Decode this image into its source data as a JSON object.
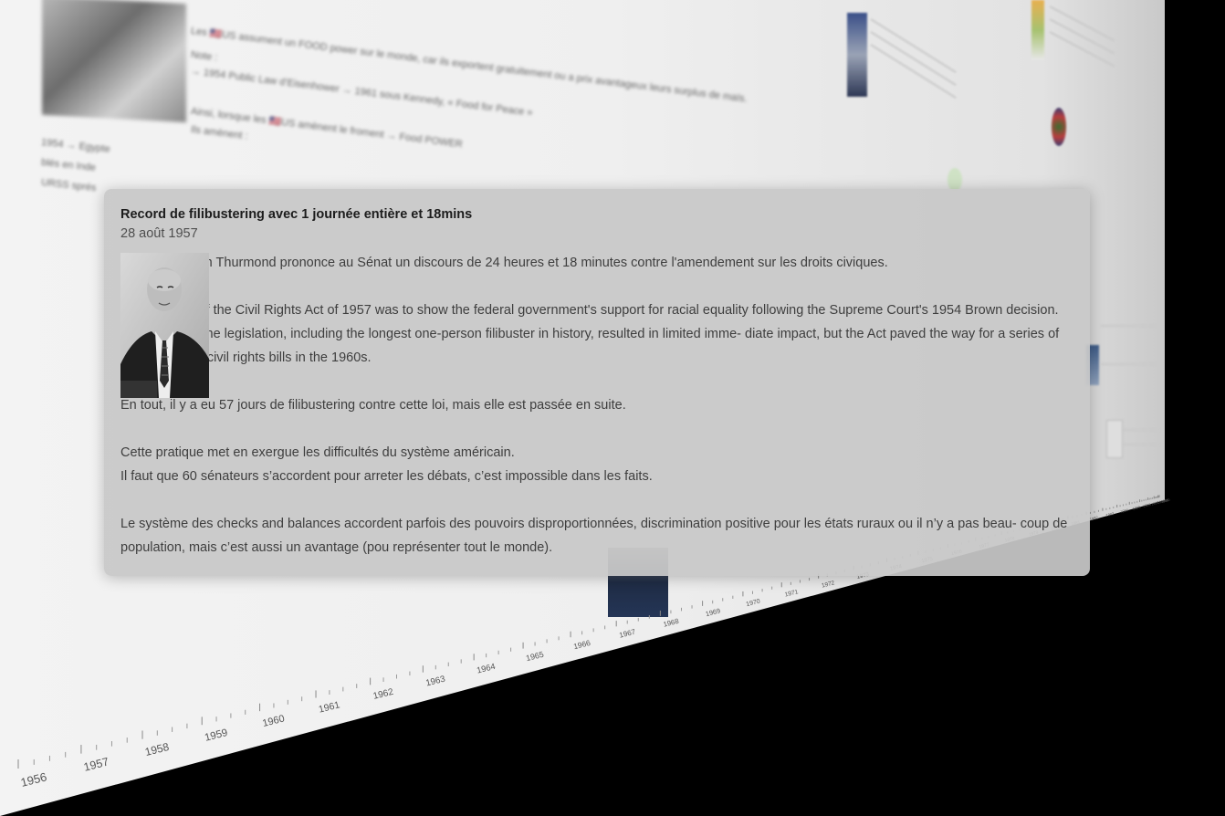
{
  "card": {
    "title": "Record de filibustering avec 1 journée entière et 18mins",
    "date": "28 août 1957",
    "paragraphs": [
      "En 1957, Strom Thurmond prononce au Sénat un discours de 24 heures et 18 minutes contre l'amendement sur les droits civiques.",
      "The purpose of the Civil Rights Act of 1957 was to show the federal government's support for racial equality following the Supreme Court's 1954 Brown decision. Opposition to the legislation, including the longest one-person filibuster in history, resulted in limited imme- diate impact, but the Act paved the way for a series of more effective civil rights bills in the 1960s.",
      "En tout, il y a eu 57 jours de filibustering contre cette loi, mais elle est passée en suite.",
      "Cette pratique met en exergue les difficultés du système américain.",
      "Il faut que 60 sénateurs s’accordent pour arreter les débats, c’est impossible dans les faits.",
      "Le système des checks and balances accordent parfois des pouvoirs disproportionnées, discrimination positive pour les états ruraux ou il n’y a pas beau- coup de population, mais c’est aussi un avantage (pou représenter tout le monde)."
    ],
    "image": "portrait-photo"
  },
  "background": {
    "text_lines": [
      "Les 🇺🇸US assument un FOOD power sur le monde, car ils exportent gratuitement ou a prix avantageux leurs surplus de maïs.",
      "Note :",
      "→ 1954 Public Law d’Eisenhower → 1961 sous Kennedy, « Food for Peace »",
      "Ainsi, lorsque les 🇺🇸US amènent le froment → Food POWER",
      "Ils amènent :",
      "1954 → Egypte",
      "blés en Inde",
      "URSS sprés"
    ]
  },
  "timeline": {
    "years": [
      "1956",
      "1957",
      "1958",
      "1959",
      "1960",
      "1961",
      "1962",
      "1963",
      "1964",
      "1965",
      "1966",
      "1967",
      "1968",
      "1969",
      "1970",
      "1971",
      "1972",
      "1973",
      "1974",
      "1975",
      "1976",
      "1977",
      "1978",
      "1979",
      "1980",
      "1981",
      "1982",
      "1983",
      "1984",
      "1985",
      "1986",
      "1987",
      "1988",
      "1989",
      "1990"
    ]
  },
  "colors": {
    "stage": "#000000",
    "card": "#c8c8c8",
    "title": "#1c1c1c",
    "text": "#3e3e3e"
  }
}
